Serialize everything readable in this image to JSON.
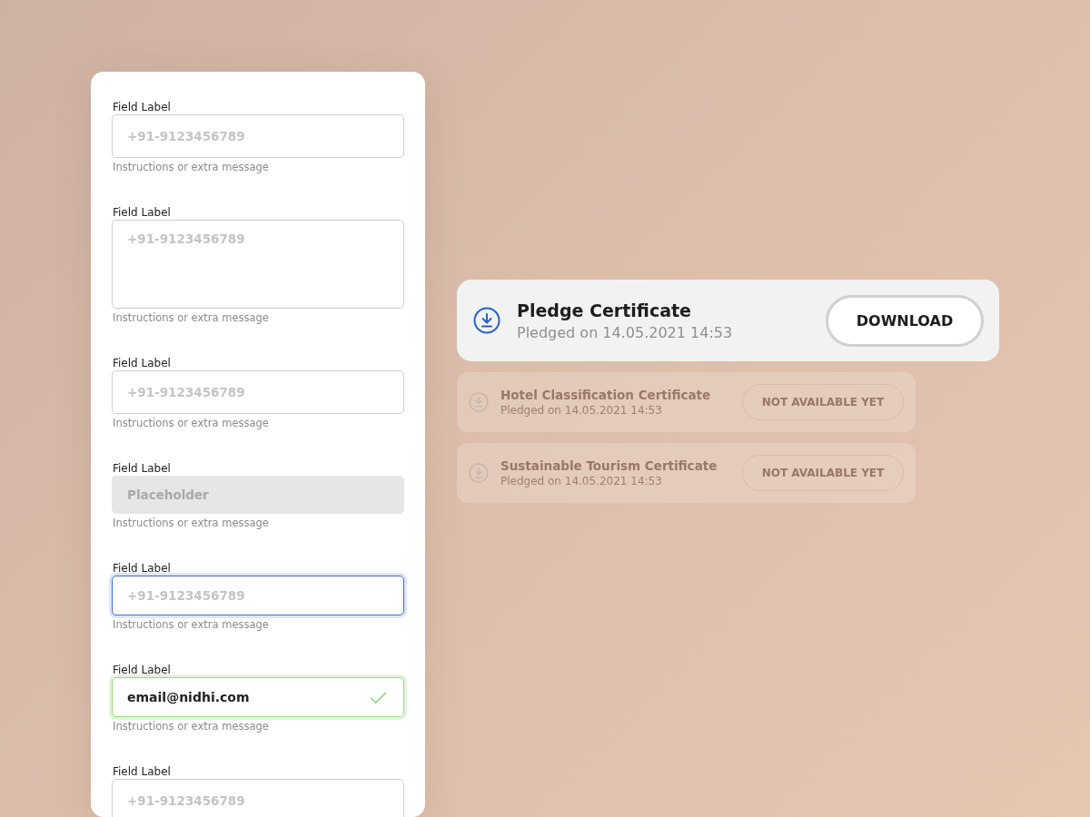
{
  "form_fields": [
    {
      "kind": "text",
      "label": "Field Label",
      "placeholder": "+91-9123456789",
      "helper": "Instructions or extra message"
    },
    {
      "kind": "multiline",
      "label": "Field Label",
      "placeholder": "+91-9123456789",
      "helper": "Instructions or extra message"
    },
    {
      "kind": "text",
      "label": "Field Label",
      "placeholder": "+91-9123456789",
      "helper": "Instructions or extra message"
    },
    {
      "kind": "disabled",
      "label": "Field Label",
      "placeholder": "Placeholder",
      "helper": "Instructions or extra message"
    },
    {
      "kind": "focused",
      "label": "Field Label",
      "placeholder": "+91-9123456789",
      "helper": "Instructions or extra message"
    },
    {
      "kind": "valid",
      "label": "Field Label",
      "value": "email@nidhi.com",
      "helper": "Instructions or extra message"
    },
    {
      "kind": "text",
      "label": "Field Label",
      "placeholder": "+91-9123456789"
    }
  ],
  "certificates": [
    {
      "title": "Pledge Certificate",
      "subtitle": "Pledged on 14.05.2021 14:53",
      "button": "DOWNLOAD",
      "available": true
    },
    {
      "title": "Hotel Classification Certificate",
      "subtitle": "Pledged on 14.05.2021 14:53",
      "button": "NOT AVAILABLE YET",
      "available": false
    },
    {
      "title": "Sustainable Tourism Certificate",
      "subtitle": "Pledged on 14.05.2021 14:53",
      "button": "NOT AVAILABLE YET",
      "available": false
    }
  ]
}
